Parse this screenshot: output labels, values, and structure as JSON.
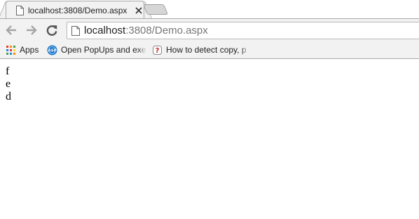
{
  "tab": {
    "title": "localhost:3808/Demo.aspx",
    "close_icon": "close-icon",
    "favicon": "page-icon"
  },
  "toolbar": {
    "back_icon": "back-arrow-icon",
    "forward_icon": "forward-arrow-icon",
    "reload_icon": "reload-icon"
  },
  "omnibox": {
    "host": "localhost",
    "rest": ":3808/Demo.aspx"
  },
  "bookmarks": [
    {
      "label": "Apps",
      "icon": "apps-grid-icon"
    },
    {
      "label": "Open PopUps and exe",
      "icon": "asp-net-icon"
    },
    {
      "label": "How to detect copy, p",
      "icon": "question-doc-icon"
    }
  ],
  "content": {
    "lines": [
      "f",
      "e",
      "d"
    ]
  },
  "colors": {
    "chrome_gray": "#f2f2f2",
    "border": "#a8a8a8",
    "url_gray": "#777777"
  }
}
